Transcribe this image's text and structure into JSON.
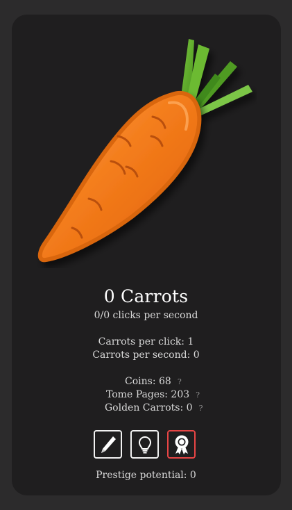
{
  "counter": {
    "title": "0 Carrots",
    "clicks_per_second": "0/0 clicks per second"
  },
  "stats": {
    "per_click": "Carrots per click: 1",
    "per_second": "Carrots per second: 0"
  },
  "resources": [
    {
      "label": "Coins: 68",
      "help": "?"
    },
    {
      "label": "Tome Pages: 203",
      "help": "?"
    },
    {
      "label": "Golden Carrots: 0",
      "help": "?"
    }
  ],
  "buttons": [
    {
      "icon": "pencil-icon",
      "active": false
    },
    {
      "icon": "lightbulb-icon",
      "active": false
    },
    {
      "icon": "award-ribbon-icon",
      "active": true
    }
  ],
  "prestige": "Prestige potential: 0",
  "colors": {
    "background": "#2c2b2c",
    "panel": "#1f1e1f",
    "carrot": "#f07a1e",
    "leaves": "#5faa2b",
    "active_border": "#e84545"
  }
}
